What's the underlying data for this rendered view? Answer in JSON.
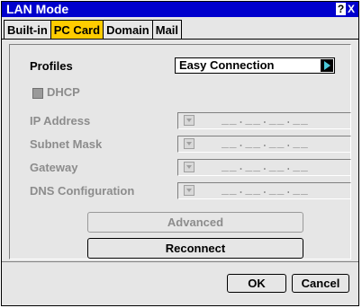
{
  "window": {
    "title": "LAN Mode",
    "help_label": "?",
    "close_label": "X"
  },
  "tabs": [
    {
      "label": "Built-in",
      "active": false
    },
    {
      "label": "PC Card",
      "active": true
    },
    {
      "label": "Domain",
      "active": false
    },
    {
      "label": "Mail",
      "active": false
    }
  ],
  "profiles": {
    "label": "Profiles",
    "value": "Easy Connection"
  },
  "dhcp": {
    "label": "DHCP",
    "checked": true,
    "enabled": false
  },
  "fields": [
    {
      "label": "IP Address",
      "value": "__.__.__.__"
    },
    {
      "label": "Subnet Mask",
      "value": "__.__.__.__"
    },
    {
      "label": "Gateway",
      "value": "__.__.__.__"
    },
    {
      "label": "DNS Configuration",
      "value": "__.__.__.__"
    }
  ],
  "buttons": {
    "advanced": "Advanced",
    "reconnect": "Reconnect",
    "ok": "OK",
    "cancel": "Cancel"
  },
  "colors": {
    "title_bg": "#0000cd",
    "active_tab": "#ffcc00",
    "dialog_bg": "#e6e6e6",
    "arrow": "#4cc9d9"
  }
}
